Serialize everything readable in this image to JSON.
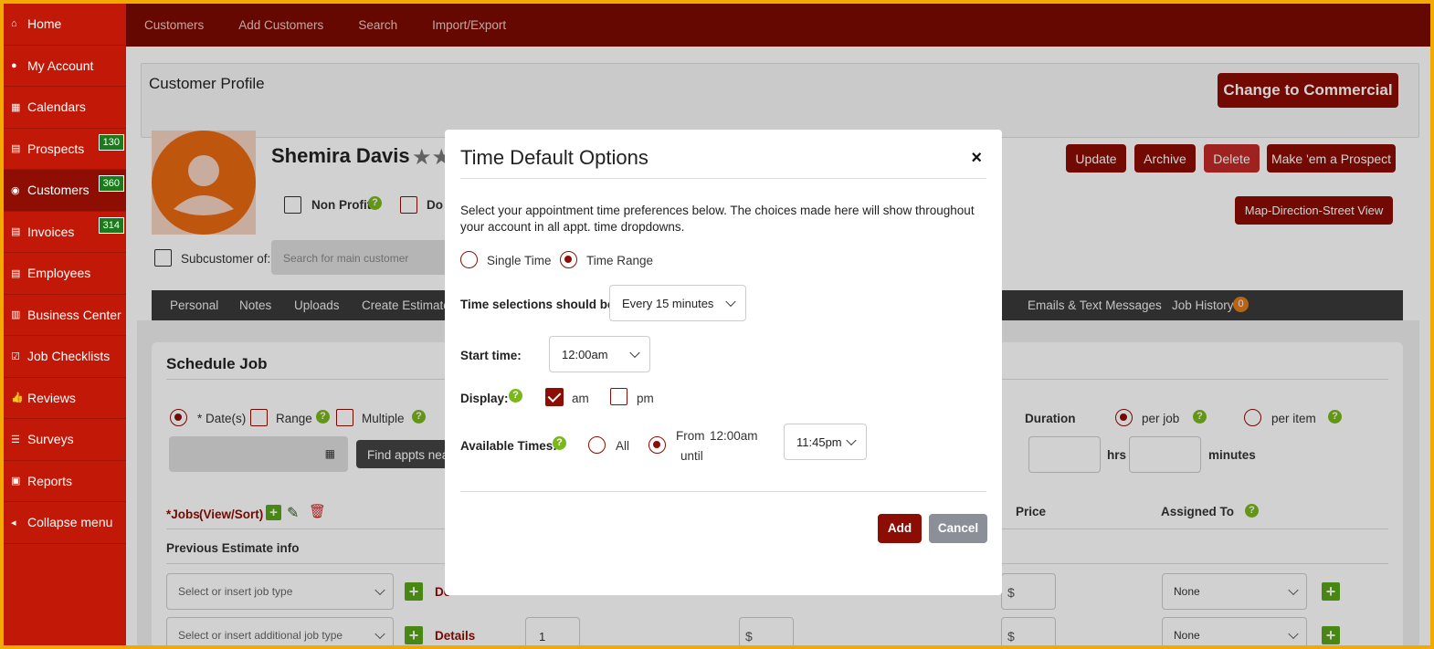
{
  "sidebar": {
    "items": [
      {
        "label": "Home",
        "icon": "home-icon"
      },
      {
        "label": "My Account",
        "icon": "user-circle-icon"
      },
      {
        "label": "Calendars",
        "icon": "calendar-icon"
      },
      {
        "label": "Prospects",
        "icon": "document-icon",
        "badge": "130"
      },
      {
        "label": "Customers",
        "icon": "users-icon",
        "badge": "360"
      },
      {
        "label": "Invoices",
        "icon": "document-icon",
        "badge": "314"
      },
      {
        "label": "Employees",
        "icon": "document-icon"
      },
      {
        "label": "Business Center",
        "icon": "building-icon"
      },
      {
        "label": "Job Checklists",
        "icon": "checkbox-icon"
      },
      {
        "label": "Reviews",
        "icon": "thumbs-up-icon"
      },
      {
        "label": "Surveys",
        "icon": "list-icon"
      },
      {
        "label": "Reports",
        "icon": "report-icon"
      },
      {
        "label": "Collapse menu",
        "icon": "chevron-left-circle-icon"
      }
    ]
  },
  "topnav": [
    "Customers",
    "Add Customers",
    "Search",
    "Import/Export"
  ],
  "profile": {
    "section_title": "Customer Profile",
    "commercial_button": "Change to Commercial",
    "customer_name": "Shemira Davis",
    "non_profit": "Non Profit",
    "do_label": "Do",
    "subcustomer_label": "Subcustomer of:",
    "subcustomer_placeholder": "Search for main customer",
    "actions": {
      "update": "Update",
      "archive": "Archive",
      "delete": "Delete",
      "prospect": "Make 'em a Prospect",
      "map": "Map-Direction-Street View"
    }
  },
  "tabs": {
    "left": [
      "Personal",
      "Notes",
      "Uploads",
      "Create Estimate"
    ],
    "right": [
      "Emails & Text Messages",
      "Job History"
    ],
    "job_history_count": "0"
  },
  "schedule": {
    "title": "Schedule Job",
    "dates_label": "* Date(s)",
    "range_label": "Range",
    "multiple_label": "Multiple",
    "find_button": "Find appts nea",
    "duration_label": "Duration",
    "per_job": "per job",
    "per_item": "per item",
    "hrs": "hrs",
    "minutes": "minutes",
    "jobs_label": "*Jobs",
    "view_sort": "(View/Sort)",
    "prev_estimate": "Previous Estimate info",
    "price_label": "Price",
    "assigned_label": "Assigned To",
    "job_type_placeholder": "Select or insert job type",
    "additional_job_type_placeholder": "Select or insert additional job type",
    "details_label": "Details",
    "details_short": "De",
    "qty_value": "1",
    "dollar": "$",
    "assigned_value": "None"
  },
  "modal": {
    "title": "Time Default Options",
    "close": "×",
    "description": "Select your appointment time preferences below. The choices made here will show throughout your account in all appt. time dropdowns.",
    "single_time": "Single Time",
    "time_range": "Time Range",
    "selections_label": "Time selections should be",
    "selections_value": "Every 15 minutes",
    "start_label": "Start time:",
    "start_value": "12:00am",
    "display_label": "Display:",
    "am": "am",
    "pm": "pm",
    "available_label": "Available Times:",
    "all": "All",
    "from_label": "From",
    "from_value": "12:00am",
    "until_label": "until",
    "until_value": "11:45pm",
    "add_button": "Add",
    "cancel_button": "Cancel"
  },
  "colors": {
    "sidebar": "#c21807",
    "topnav": "#7c0a02",
    "accent": "#8b0d04",
    "help": "#7ab81a",
    "border": "#f2a900"
  }
}
